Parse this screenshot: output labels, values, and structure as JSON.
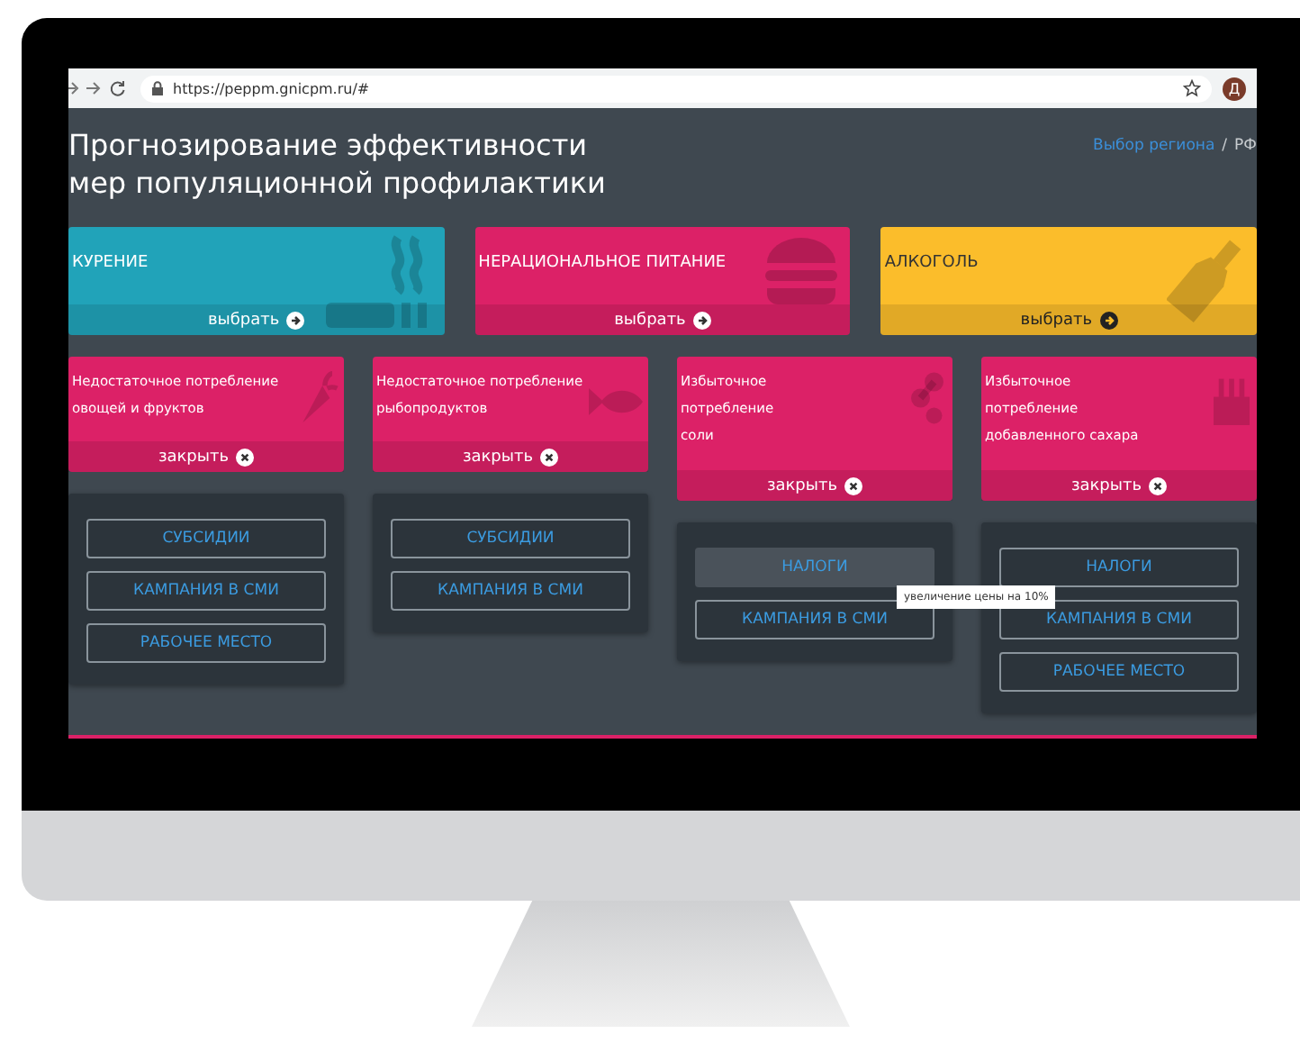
{
  "browser": {
    "url": "https://peppm.gnicpm.ru/#",
    "avatar": "Д"
  },
  "header": {
    "title": "Прогнозирование эффективности мер популяционной профилактики",
    "breadcrumb_link": "Выбор региона",
    "breadcrumb_separator": "/",
    "breadcrumb_current": "РФ"
  },
  "categories": [
    {
      "label": "КУРЕНИЕ",
      "action": "выбрать",
      "color": "#21a3b9",
      "kind": "cigarette"
    },
    {
      "label": "НЕРАЦИОНАЛЬНОЕ ПИТАНИЕ",
      "action": "выбрать",
      "color": "#dc2167",
      "kind": "burger"
    },
    {
      "label": "АЛКОГОЛЬ",
      "action": "выбрать",
      "color": "#fbbd2b",
      "kind": "bottle"
    }
  ],
  "subcategories": [
    {
      "label": "Недостаточное потребление\nовощей и фруктов",
      "action": "закрыть",
      "kind": "carrot",
      "measures": [
        {
          "label": "СУБСИДИИ",
          "highlighted": false
        },
        {
          "label": "КАМПАНИЯ В СМИ",
          "highlighted": false
        },
        {
          "label": "РАБОЧЕЕ МЕСТО",
          "highlighted": false
        }
      ]
    },
    {
      "label": "Недостаточное потребление\nрыбопродуктов",
      "action": "закрыть",
      "kind": "fish",
      "measures": [
        {
          "label": "СУБСИДИИ",
          "highlighted": false
        },
        {
          "label": "КАМПАНИЯ В СМИ",
          "highlighted": false
        }
      ]
    },
    {
      "label": "Избыточное\nпотребление\nсоли",
      "action": "закрыть",
      "kind": "salt",
      "measures": [
        {
          "label": "НАЛОГИ",
          "highlighted": true,
          "tooltip": "увеличение цены на 10%"
        },
        {
          "label": "КАМПАНИЯ В СМИ",
          "highlighted": false
        }
      ]
    },
    {
      "label": "Избыточное\nпотребление\nдобавленного сахара",
      "action": "закрыть",
      "kind": "cake",
      "measures": [
        {
          "label": "НАЛОГИ",
          "highlighted": false
        },
        {
          "label": "КАМПАНИЯ В СМИ",
          "highlighted": false
        },
        {
          "label": "РАБОЧЕЕ МЕСТО",
          "highlighted": false
        }
      ]
    }
  ]
}
